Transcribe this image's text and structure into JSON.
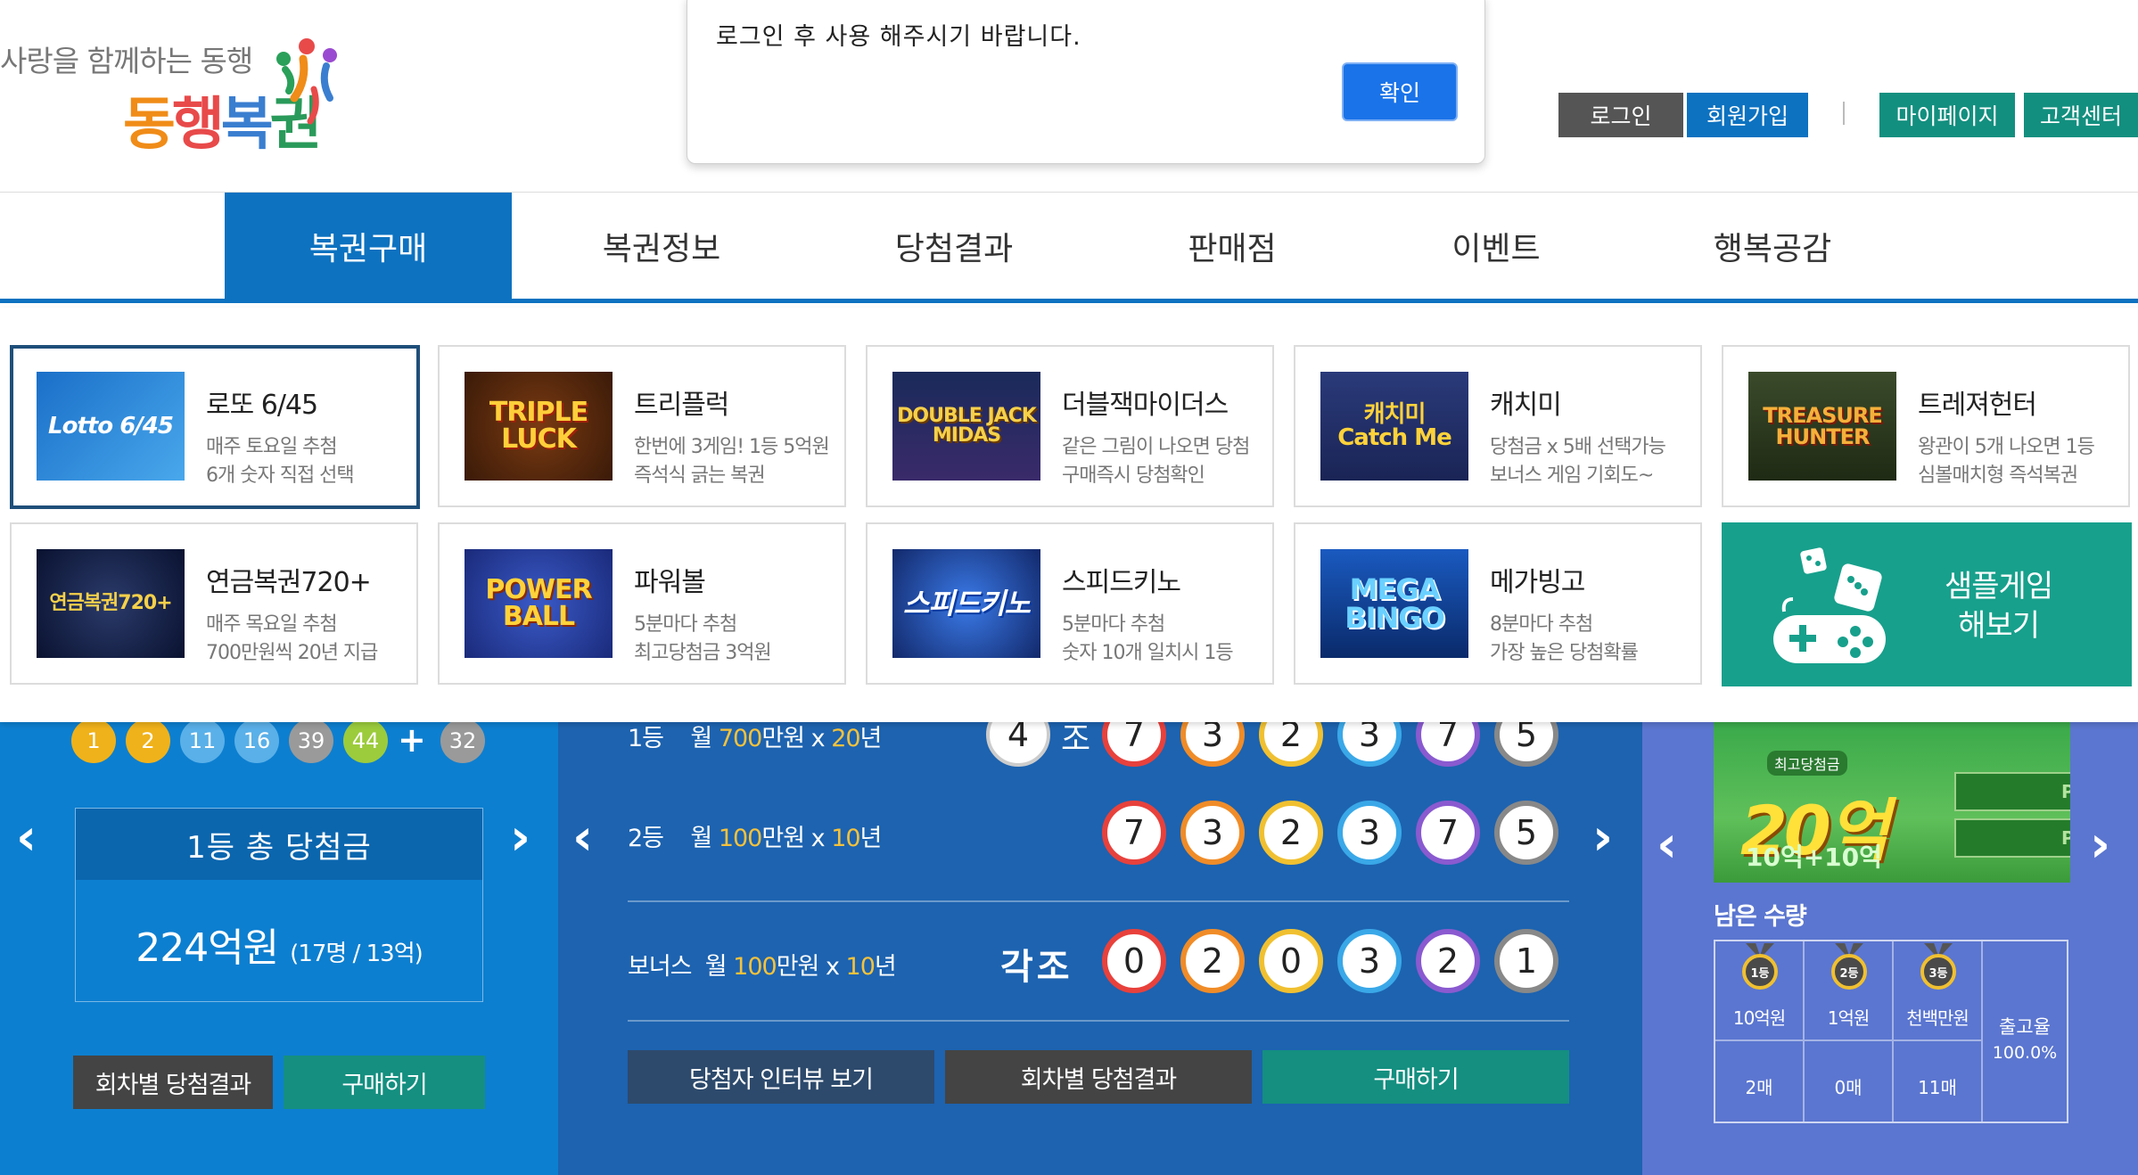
{
  "header": {
    "tagline": "사랑을 함께하는 동행",
    "logo_chars": [
      "동",
      "행",
      "복",
      "권"
    ],
    "links": [
      {
        "label": "로그인",
        "color": "#555555"
      },
      {
        "label": "회원가입",
        "color": "#0d72c0"
      },
      {
        "label": "마이페이지",
        "color": "#138f7f"
      },
      {
        "label": "고객센터",
        "color": "#138f7f"
      }
    ]
  },
  "dialog": {
    "message": "로그인 후 사용 해주시기 바랍니다.",
    "ok_label": "확인"
  },
  "nav": {
    "items": [
      "복권구매",
      "복권정보",
      "당첨결과",
      "판매점",
      "이벤트",
      "행복공감"
    ],
    "active_index": 0
  },
  "games": [
    {
      "title": "로또 6/45",
      "desc1": "매주 토요일 추첨",
      "desc2": "6개 숫자 직접 선택",
      "thumb_text": "Lotto 6/45",
      "icon": "lotto-logo-icon"
    },
    {
      "title": "트리플럭",
      "desc1": "한번에 3게임! 1등 5억원",
      "desc2": "즉석식 긁는 복권",
      "thumb_text": "TRIPLE LUCK",
      "icon": "triple-luck-logo-icon"
    },
    {
      "title": "더블잭마이더스",
      "desc1": "같은 그림이 나오면 당첨",
      "desc2": "구매즉시 당첨확인",
      "thumb_text": "DOUBLE JACK MIDAS",
      "icon": "doublejack-midas-logo-icon"
    },
    {
      "title": "캐치미",
      "desc1": "당첨금 x 5배 선택가능",
      "desc2": "보너스 게임 기회도~",
      "thumb_text": "캐치미 Catch Me",
      "icon": "catch-me-logo-icon"
    },
    {
      "title": "트레져헌터",
      "desc1": "왕관이 5개 나오면 1등",
      "desc2": "심볼매치형 즉석복권",
      "thumb_text": "TREASURE HUNTER",
      "icon": "treasure-hunter-logo-icon"
    },
    {
      "title": "연금복권720+",
      "desc1": "매주 목요일 추첨",
      "desc2": "700만원씩 20년 지급",
      "thumb_text": "연금복권720+",
      "icon": "pension-720-logo-icon"
    },
    {
      "title": "파워볼",
      "desc1": "5분마다 추첨",
      "desc2": "최고당첨금 3억원",
      "thumb_text": "POWER BALL",
      "icon": "powerball-logo-icon"
    },
    {
      "title": "스피드키노",
      "desc1": "5분마다 추첨",
      "desc2": "숫자 10개 일치시 1등",
      "thumb_text": "스피드키노",
      "icon": "speed-keno-logo-icon"
    },
    {
      "title": "메가빙고",
      "desc1": "8분마다 추첨",
      "desc2": "가장 높은 당첨확률",
      "thumb_text": "MEGA BINGO",
      "icon": "mega-bingo-logo-icon"
    }
  ],
  "sample_game": {
    "line1": "샘플게임",
    "line2": "해보기"
  },
  "lotto_panel": {
    "numbers": [
      {
        "n": "1",
        "color": "#f0b21a"
      },
      {
        "n": "2",
        "color": "#f0b21a"
      },
      {
        "n": "11",
        "color": "#5ab0e8"
      },
      {
        "n": "16",
        "color": "#5ab0e8"
      },
      {
        "n": "39",
        "color": "#9a9a9a"
      },
      {
        "n": "44",
        "color": "#9ccc3c"
      }
    ],
    "plus": "+",
    "bonus": {
      "n": "32",
      "color": "#9a9a9a"
    },
    "total_label": "1등 총 당첨금",
    "total_amount": "224억원",
    "total_detail": "(17명 / 13억)",
    "btn_results": "회차별 당첨결과",
    "btn_buy": "구매하기"
  },
  "pension_panel": {
    "rows": [
      {
        "rank": "1등",
        "pre": "월 ",
        "amount": "700",
        "unit": "만원 x ",
        "years": "20",
        "yunit": "년"
      },
      {
        "rank": "2등",
        "pre": "월 ",
        "amount": "100",
        "unit": "만원 x ",
        "years": "10",
        "yunit": "년"
      },
      {
        "rank": "보너스",
        "pre": "월 ",
        "amount": "100",
        "unit": "만원 x ",
        "years": "10",
        "yunit": "년"
      }
    ],
    "row1_group": "4",
    "row1_group_suffix": "조",
    "row1_digits": [
      "7",
      "3",
      "2",
      "3",
      "7",
      "5"
    ],
    "row2_digits": [
      "7",
      "3",
      "2",
      "3",
      "7",
      "5"
    ],
    "bonus_group": "각조",
    "bonus_digits": [
      "0",
      "2",
      "0",
      "3",
      "2",
      "1"
    ],
    "digit_colors": [
      "#e8413c",
      "#f08c28",
      "#f0c030",
      "#3aa8e8",
      "#8a5ad0",
      "#888888"
    ],
    "btn_interview": "당첨자 인터뷰 보기",
    "btn_results": "회차별 당첨결과",
    "btn_buy": "구매하기"
  },
  "instant_panel": {
    "promo_tag": "최고당첨금",
    "promo_prize": "20억",
    "promo_sub": "10억+10억",
    "promo_slot": "PRIZE",
    "remain_label": "남은 수량",
    "tiers": [
      {
        "medal": "1등",
        "name": "10억원",
        "count": "2매"
      },
      {
        "medal": "2등",
        "name": "1억원",
        "count": "0매"
      },
      {
        "medal": "3등",
        "name": "천백만원",
        "count": "11매"
      }
    ],
    "rate_label": "출고율",
    "rate_value": "100.0%"
  }
}
